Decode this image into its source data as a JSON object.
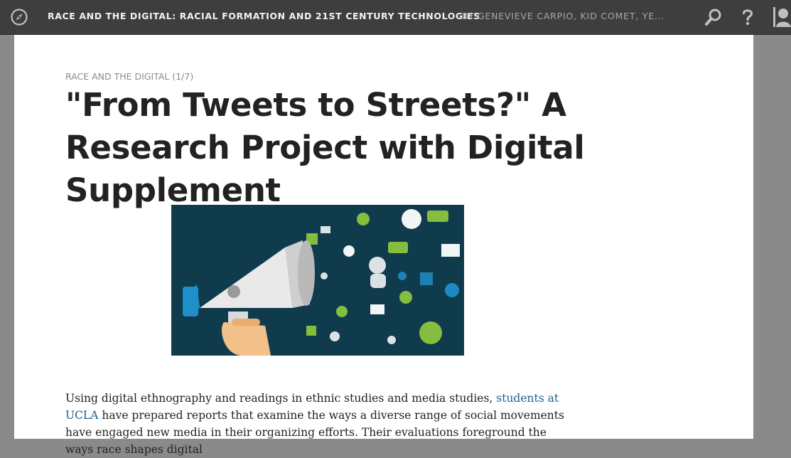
{
  "header": {
    "book_title": "RACE AND THE DIGITAL: RACIAL FORMATION AND 21ST CENTURY TECHNOLOGIES",
    "byline": "BY GENEVIEVE CARPIO, KID COMET, YE..."
  },
  "icons": {
    "nav": "compass-icon",
    "search": "search-icon",
    "help": "help-icon",
    "user": "user-icon"
  },
  "page": {
    "breadcrumb": "RACE AND THE DIGITAL (1/7)",
    "title": "\"From Tweets to Streets?\" A Research Project with Digital Supplement",
    "image_subject": "megaphone-with-social-media-icons",
    "body": {
      "before_link": "Using digital ethnography and readings in ethnic studies and media studies, ",
      "link_text": "students at UCLA",
      "after_link": " have prepared reports that examine the ways a diverse range of social movements have engaged new media in their organizing efforts. Their evaluations foreground the ways race shapes digital"
    }
  },
  "colors": {
    "topbar": "#3e3e3e",
    "page_background": "#8a8a8a",
    "link": "#1a5e8c",
    "hero_background": "#0f3b4c",
    "hero_green": "#8cc63f",
    "hero_blue": "#1f8fc9"
  }
}
